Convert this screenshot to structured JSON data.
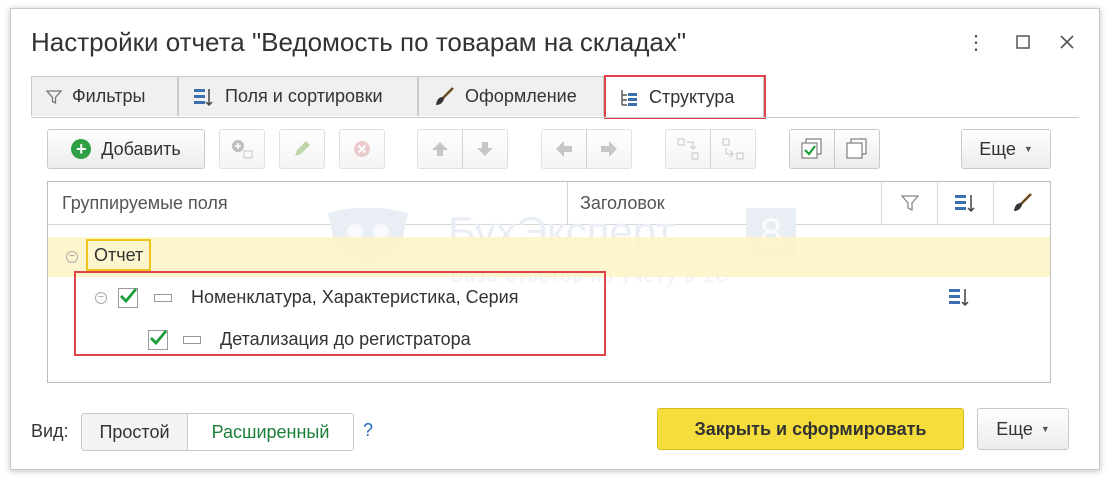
{
  "window": {
    "title": "Настройки отчета \"Ведомость по товарам на складах\""
  },
  "tabs": [
    {
      "label": "Фильтры"
    },
    {
      "label": "Поля и сортировки"
    },
    {
      "label": "Оформление"
    },
    {
      "label": "Структура"
    }
  ],
  "toolbar": {
    "add_label": "Добавить",
    "more_label": "Еще"
  },
  "table": {
    "columns": [
      "Группируемые поля",
      "Заголовок"
    ],
    "rows": [
      {
        "label": "Отчет"
      },
      {
        "label": "Номенклатура, Характеристика, Серия",
        "checked": true
      },
      {
        "label": "Детализация до регистратора",
        "checked": true
      }
    ]
  },
  "watermark": {
    "brand": "БухЭксперт",
    "digit": "8",
    "tagline": "База ответов по учёту в 1С"
  },
  "footer": {
    "view_label": "Вид:",
    "mode_simple": "Простой",
    "mode_extended": "Расширенный",
    "help": "?",
    "close_and_build": "Закрыть и сформировать",
    "more_label": "Еще"
  },
  "colors": {
    "accent_yellow": "#f5de3c",
    "highlight_row": "#fdf3c4",
    "red_frame": "#e0434b",
    "check_green": "#1a9e3a",
    "active_mode": "#1a7f37"
  }
}
